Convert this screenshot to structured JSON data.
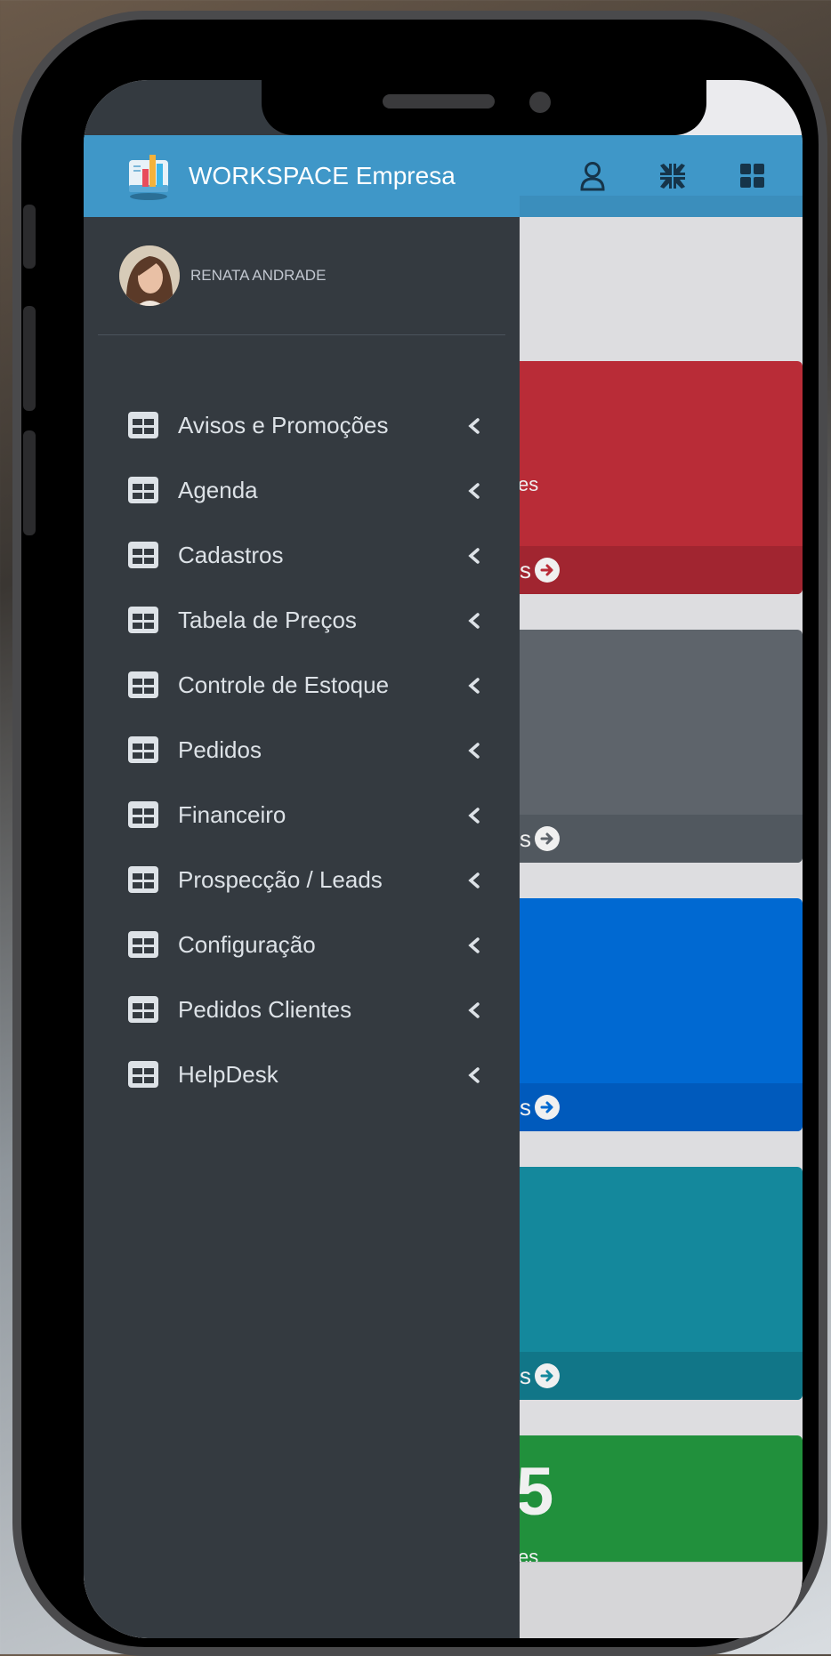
{
  "brand": {
    "title": "WORKSPACE Empresa"
  },
  "user": {
    "name": "RENATA ANDRADE"
  },
  "menu": {
    "items": [
      {
        "label": "Avisos e Promoções"
      },
      {
        "label": "Agenda"
      },
      {
        "label": "Cadastros"
      },
      {
        "label": "Tabela de Preços"
      },
      {
        "label": "Controle de Estoque"
      },
      {
        "label": "Pedidos"
      },
      {
        "label": "Financeiro"
      },
      {
        "label": "Prospecção / Leads"
      },
      {
        "label": "Configuração"
      },
      {
        "label": "Pedidos Clientes"
      },
      {
        "label": "HelpDesk"
      }
    ]
  },
  "topbar": {
    "icons": [
      "user-icon",
      "compress-icon",
      "grid-icon"
    ]
  },
  "cards": [
    {
      "color": "#c52f3b",
      "footer_color": "#ac2833",
      "mid_text": "es",
      "footer_text": "s",
      "big_text": ""
    },
    {
      "color": "#646b72",
      "footer_color": "#575e65",
      "mid_text": "",
      "footer_text": "s",
      "big_text": ""
    },
    {
      "color": "#0170e0",
      "footer_color": "#0160c8",
      "mid_text": "",
      "footer_text": "s",
      "big_text": ""
    },
    {
      "color": "#1691a6",
      "footer_color": "#137e91",
      "mid_text": "",
      "footer_text": "s",
      "big_text": ""
    },
    {
      "color": "#249a40",
      "footer_color": "#249a40",
      "mid_text": "es",
      "footer_text": "",
      "big_text": "5"
    }
  ],
  "colors": {
    "header": "#3f97c8",
    "sidebar": "#343a40",
    "menu_text": "#dde2e7"
  }
}
